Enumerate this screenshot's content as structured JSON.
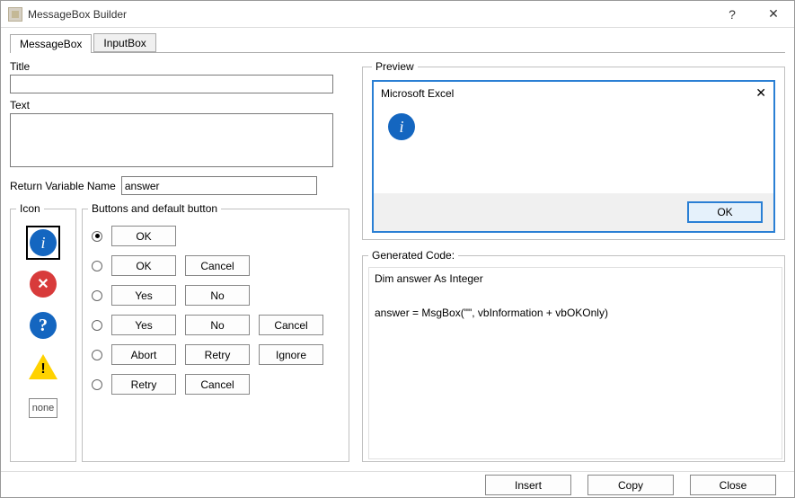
{
  "window": {
    "title": "MessageBox Builder"
  },
  "tabs": [
    "MessageBox",
    "InputBox"
  ],
  "left": {
    "title_label": "Title",
    "title_value": "",
    "text_label": "Text",
    "text_value": "",
    "retvar_label": "Return Variable Name",
    "retvar_value": "answer"
  },
  "iconGroup": {
    "legend": "Icon",
    "none_label": "none",
    "selected": 0
  },
  "buttonsGroup": {
    "legend": "Buttons and default button",
    "rows": [
      {
        "sel": true,
        "btns": [
          "OK"
        ]
      },
      {
        "sel": false,
        "btns": [
          "OK",
          "Cancel"
        ]
      },
      {
        "sel": false,
        "btns": [
          "Yes",
          "No"
        ]
      },
      {
        "sel": false,
        "btns": [
          "Yes",
          "No",
          "Cancel"
        ]
      },
      {
        "sel": false,
        "btns": [
          "Abort",
          "Retry",
          "Ignore"
        ]
      },
      {
        "sel": false,
        "btns": [
          "Retry",
          "Cancel"
        ]
      }
    ]
  },
  "preview": {
    "legend": "Preview",
    "msgbox_title": "Microsoft Excel",
    "ok_label": "OK"
  },
  "generated": {
    "legend": "Generated Code:",
    "code": "Dim answer As Integer\n\nanswer = MsgBox(\"\", vbInformation + vbOKOnly)"
  },
  "bottom": {
    "insert": "Insert",
    "copy": "Copy",
    "close": "Close"
  }
}
